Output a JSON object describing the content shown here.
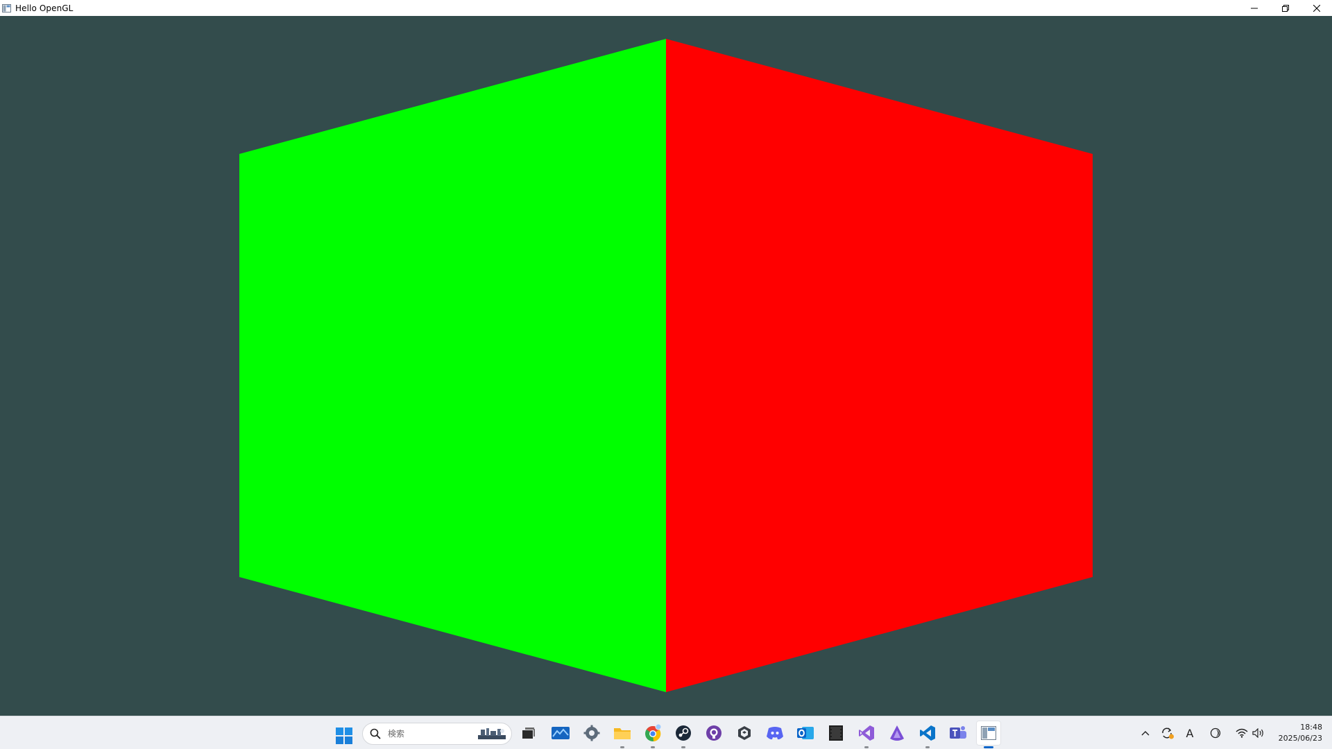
{
  "window": {
    "title": "Hello OpenGL",
    "controls": {
      "minimize": "minimize-icon",
      "maximize": "restore-icon",
      "close": "close-icon"
    }
  },
  "scene": {
    "clear_color": "#334c4c",
    "faces": [
      {
        "name": "left-face",
        "color": "#00ff00"
      },
      {
        "name": "right-face",
        "color": "#ff0000"
      }
    ]
  },
  "taskbar": {
    "search": {
      "placeholder": "検索"
    },
    "apps": [
      {
        "name": "task-view",
        "icon": "task-view-icon"
      },
      {
        "name": "widgets",
        "icon": "widgets-icon"
      },
      {
        "name": "settings",
        "icon": "gear-icon"
      },
      {
        "name": "file-explorer",
        "icon": "folder-icon"
      },
      {
        "name": "chrome",
        "icon": "chrome-icon"
      },
      {
        "name": "steam",
        "icon": "steam-icon"
      },
      {
        "name": "github-desktop",
        "icon": "github-icon"
      },
      {
        "name": "unity-hub",
        "icon": "unity-icon"
      },
      {
        "name": "discord",
        "icon": "discord-icon"
      },
      {
        "name": "outlook",
        "icon": "outlook-icon"
      },
      {
        "name": "terminal",
        "icon": "terminal-icon"
      },
      {
        "name": "visual-studio",
        "icon": "visual-studio-icon"
      },
      {
        "name": "affinity",
        "icon": "affinity-icon"
      },
      {
        "name": "vscode",
        "icon": "vscode-icon"
      },
      {
        "name": "teams",
        "icon": "teams-icon"
      },
      {
        "name": "hello-opengl",
        "icon": "opengl-app-icon"
      }
    ],
    "tray": {
      "icons": [
        "chevron-up-icon",
        "sync-icon",
        "ime-icon",
        "moon-icon",
        "wifi-icon",
        "volume-icon"
      ],
      "ime_label": "A",
      "time": "18:48",
      "date": "2025/06/23"
    }
  }
}
